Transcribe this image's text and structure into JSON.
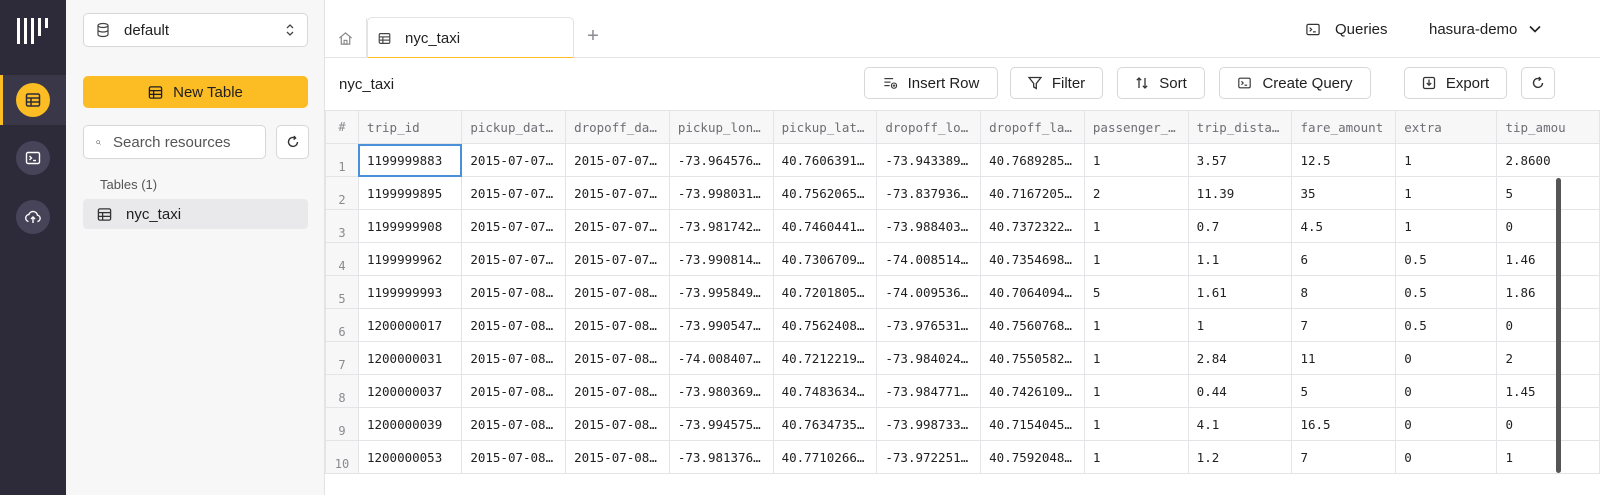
{
  "sidebar": {
    "database": "default",
    "new_table_label": "New Table",
    "search_placeholder": "Search resources",
    "tables_heading": "Tables (1)",
    "tables": [
      {
        "label": "nyc_taxi"
      }
    ]
  },
  "topbar": {
    "tab_label": "nyc_taxi",
    "add_tab": "+",
    "queries_label": "Queries",
    "project_label": "hasura-demo"
  },
  "toolbar": {
    "title": "nyc_taxi",
    "insert_row_label": "Insert Row",
    "filter_label": "Filter",
    "sort_label": "Sort",
    "create_query_label": "Create Query",
    "export_label": "Export"
  },
  "colors": {
    "accent": "#fbbd23",
    "rail": "#2d2b3a",
    "selection": "#4a90d9"
  },
  "grid": {
    "rownum_header": "#",
    "columns": [
      "trip_id",
      "pickup_dat…",
      "dropoff_da…",
      "pickup_lon…",
      "pickup_lat…",
      "dropoff_lo…",
      "dropoff_la…",
      "passenger_…",
      "trip_dista…",
      "fare_amount",
      "extra",
      "tip_amou"
    ],
    "rows": [
      {
        "n": "1",
        "cells": [
          "1199999883",
          "2015-07-07…",
          "2015-07-07…",
          "-73.964576…",
          "40.7606391…",
          "-73.943389…",
          "40.7689285…",
          "1",
          "3.57",
          "12.5",
          "1",
          "2.8600"
        ]
      },
      {
        "n": "2",
        "cells": [
          "1199999895",
          "2015-07-07…",
          "2015-07-07…",
          "-73.998031…",
          "40.7562065…",
          "-73.837936…",
          "40.7167205…",
          "2",
          "11.39",
          "35",
          "1",
          "5"
        ]
      },
      {
        "n": "3",
        "cells": [
          "1199999908",
          "2015-07-07…",
          "2015-07-07…",
          "-73.981742…",
          "40.7460441…",
          "-73.988403…",
          "40.7372322…",
          "1",
          "0.7",
          "4.5",
          "1",
          "0"
        ]
      },
      {
        "n": "4",
        "cells": [
          "1199999962",
          "2015-07-07…",
          "2015-07-07…",
          "-73.990814…",
          "40.7306709…",
          "-74.008514…",
          "40.7354698…",
          "1",
          "1.1",
          "6",
          "0.5",
          "1.46"
        ]
      },
      {
        "n": "5",
        "cells": [
          "1199999993",
          "2015-07-08…",
          "2015-07-08…",
          "-73.995849…",
          "40.7201805…",
          "-74.009536…",
          "40.7064094…",
          "5",
          "1.61",
          "8",
          "0.5",
          "1.86"
        ]
      },
      {
        "n": "6",
        "cells": [
          "1200000017",
          "2015-07-08…",
          "2015-07-08…",
          "-73.990547…",
          "40.7562408…",
          "-73.976531…",
          "40.7560768…",
          "1",
          "1",
          "7",
          "0.5",
          "0"
        ]
      },
      {
        "n": "7",
        "cells": [
          "1200000031",
          "2015-07-08…",
          "2015-07-08…",
          "-74.008407…",
          "40.7212219…",
          "-73.984024…",
          "40.7550582…",
          "1",
          "2.84",
          "11",
          "0",
          "2"
        ]
      },
      {
        "n": "8",
        "cells": [
          "1200000037",
          "2015-07-08…",
          "2015-07-08…",
          "-73.980369…",
          "40.7483634…",
          "-73.984771…",
          "40.7426109…",
          "1",
          "0.44",
          "5",
          "0",
          "1.45"
        ]
      },
      {
        "n": "9",
        "cells": [
          "1200000039",
          "2015-07-08…",
          "2015-07-08…",
          "-73.994575…",
          "40.7634735…",
          "-73.998733…",
          "40.7154045…",
          "1",
          "4.1",
          "16.5",
          "0",
          "0"
        ]
      },
      {
        "n": "10",
        "cells": [
          "1200000053",
          "2015-07-08…",
          "2015-07-08…",
          "-73.981376…",
          "40.7710266…",
          "-73.972251…",
          "40.7592048…",
          "1",
          "1.2",
          "7",
          "0",
          "1"
        ]
      }
    ]
  }
}
